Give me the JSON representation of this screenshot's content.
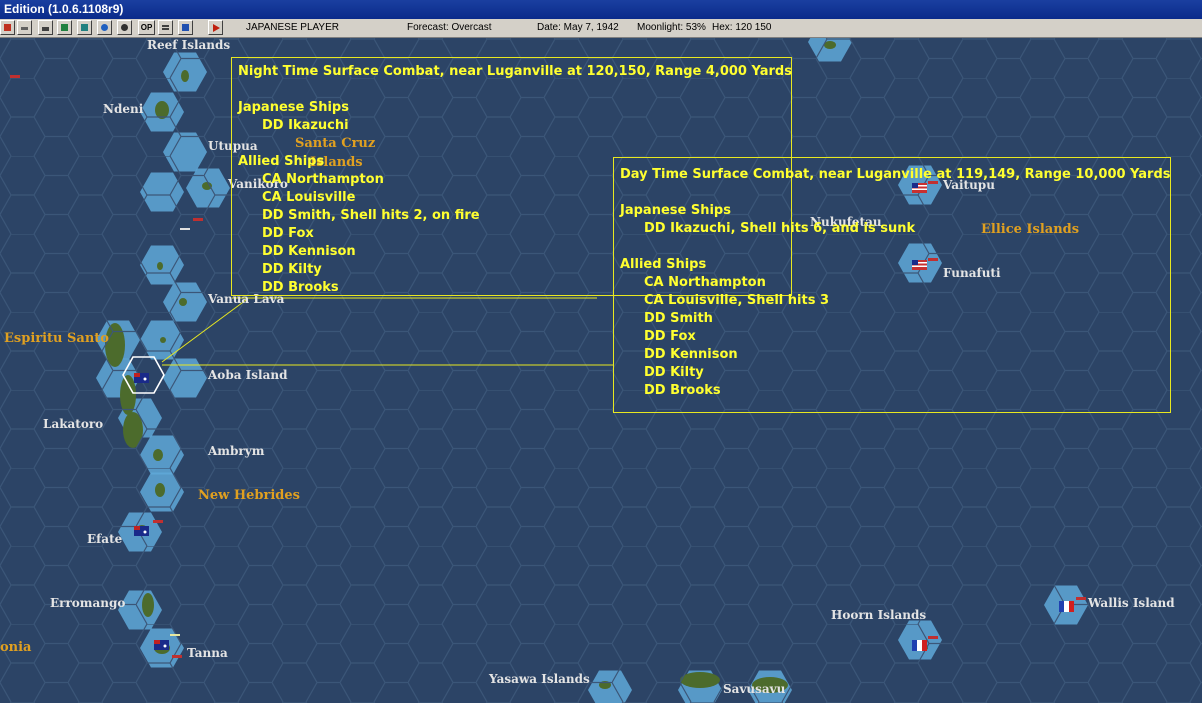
{
  "window": {
    "title": "Edition (1.0.6.1108r9)"
  },
  "toolbar": {
    "player": "JAPANESE PLAYER",
    "forecast": "Forecast: Overcast",
    "date": "Date: May 7, 1942",
    "moonlight": "Moonlight: 53%",
    "hex": "Hex: 120 150",
    "buttons": [
      "close-icon",
      "air-icon",
      "ship-icon",
      "base-icon",
      "chart-icon",
      "globe-icon",
      "gear-icon",
      "op-icon",
      "list-icon",
      "window-icon",
      "play-icon"
    ],
    "op_label": "OP"
  },
  "map": {
    "labels": [
      {
        "name": "reef-islands-label",
        "text": "Reef Islands",
        "style": "white"
      },
      {
        "name": "ndeni-label",
        "text": "Ndeni",
        "style": "white"
      },
      {
        "name": "utupua-label",
        "text": "Utupua",
        "style": "white"
      },
      {
        "name": "vanikoro-label",
        "text": "Vanikoro",
        "style": "white"
      },
      {
        "name": "santa-cruz-label",
        "text": "Santa Cruz",
        "style": "orange"
      },
      {
        "name": "santa-cruz-islands-label",
        "text": "Islands",
        "style": "orange"
      },
      {
        "name": "vanua-lava-label",
        "text": "Vanua Lava",
        "style": "white"
      },
      {
        "name": "espiritu-santo-label",
        "text": "Espiritu Santo",
        "style": "orange"
      },
      {
        "name": "aoba-island-label",
        "text": "Aoba Island",
        "style": "white"
      },
      {
        "name": "lakatoro-label",
        "text": "Lakatoro",
        "style": "white"
      },
      {
        "name": "ambrym-label",
        "text": "Ambrym",
        "style": "white"
      },
      {
        "name": "new-hebrides-label",
        "text": "New Hebrides",
        "style": "orange"
      },
      {
        "name": "efate-label",
        "text": "Efate",
        "style": "white"
      },
      {
        "name": "erromango-label",
        "text": "Erromango",
        "style": "white"
      },
      {
        "name": "tanna-label",
        "text": "Tanna",
        "style": "white"
      },
      {
        "name": "caledonia-label",
        "text": "onia",
        "style": "orange"
      },
      {
        "name": "yasawa-islands-label",
        "text": "Yasawa Islands",
        "style": "white"
      },
      {
        "name": "savusavu-label",
        "text": "Savusavu",
        "style": "white"
      },
      {
        "name": "hoorn-islands-label",
        "text": "Hoorn Islands",
        "style": "white"
      },
      {
        "name": "wallis-island-label",
        "text": "Wallis Island",
        "style": "white"
      },
      {
        "name": "vaitupu-label",
        "text": "Vaitupu",
        "style": "white"
      },
      {
        "name": "nukufetau-label",
        "text": "Nukufetau",
        "style": "white"
      },
      {
        "name": "ellice-islands-label",
        "text": "Ellice Islands",
        "style": "orange"
      },
      {
        "name": "funafuti-label",
        "text": "Funafuti",
        "style": "white"
      }
    ],
    "colors": {
      "sea": "#2c4466",
      "hex_line": "#3b5678",
      "shallow": "#5fa8d8",
      "land": "#4c6b2c",
      "combat_text": "#ffff30"
    }
  },
  "night_combat": {
    "title": "Night Time Surface Combat, near Luganville at 120,150, Range 4,000 Yards",
    "japanese_header": "Japanese Ships",
    "japanese": [
      "DD Ikazuchi"
    ],
    "allied_header": "Allied Ships",
    "allied": [
      "CA Northampton",
      "CA Louisville",
      "DD Smith, Shell hits 2,  on fire",
      "DD Fox",
      "DD Kennison",
      "DD Kilty",
      "DD Brooks"
    ]
  },
  "day_combat": {
    "title": "Day Time Surface Combat, near Luganville at 119,149, Range 10,000 Yards",
    "japanese_header": "Japanese Ships",
    "japanese": [
      "DD Ikazuchi, Shell hits 6, and is sunk"
    ],
    "allied_header": "Allied Ships",
    "allied": [
      "CA Northampton",
      "CA Louisville, Shell hits 3",
      "DD Smith",
      "DD Fox",
      "DD Kennison",
      "DD Kilty",
      "DD Brooks"
    ]
  }
}
